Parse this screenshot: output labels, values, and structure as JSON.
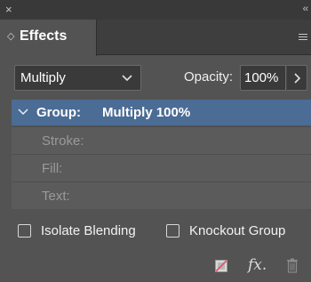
{
  "window": {
    "close_glyph": "×",
    "collapse_glyph": "‹‹"
  },
  "tab": {
    "chevron_glyph": "◇",
    "title": "Effects"
  },
  "blend": {
    "mode": "Multiply",
    "opacity_label": "Opacity:",
    "opacity_value": "100%"
  },
  "list": {
    "group": {
      "label": "Group:",
      "value": "Multiply 100%"
    },
    "rows": [
      {
        "label": "Stroke:"
      },
      {
        "label": "Fill:"
      },
      {
        "label": "Text:"
      }
    ]
  },
  "options": {
    "isolate_blending": {
      "label": "Isolate Blending",
      "checked": false
    },
    "knockout_group": {
      "label": "Knockout Group",
      "checked": false
    }
  },
  "footer": {
    "fx_label": "fx."
  },
  "colors": {
    "panel_bg": "#535353",
    "selection": "#4b6c94",
    "clear_icon_accent": "#e0566a"
  }
}
